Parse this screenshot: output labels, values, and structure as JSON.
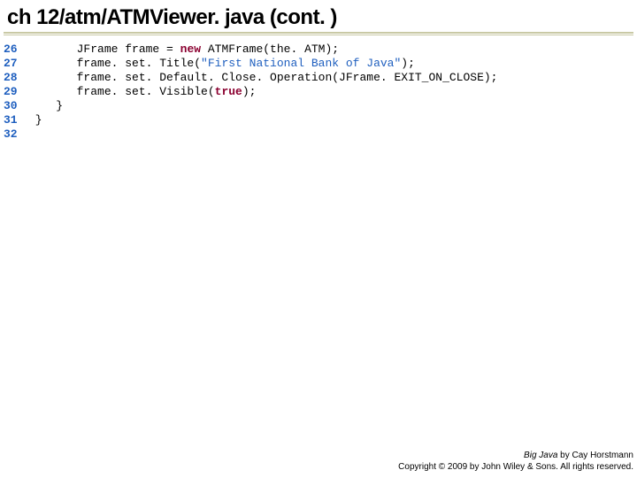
{
  "title": "ch 12/atm/ATMViewer. java (cont. )",
  "code": {
    "line_numbers": [
      "26",
      "27",
      "28",
      "29",
      "30",
      "31",
      "32"
    ],
    "l26_pre": "       JFrame frame = ",
    "l26_kw": "new",
    "l26_post": " ATMFrame(the. ATM);",
    "l27_pre": "       frame. set. Title(",
    "l27_str": "\"First National Bank of Java\"",
    "l27_post": ");",
    "l28": "       frame. set. Default. Close. Operation(JFrame. EXIT_ON_CLOSE);",
    "l29_pre": "       frame. set. Visible(",
    "l29_lit": "true",
    "l29_post": ");",
    "l30": "    }",
    "l31": " }",
    "l32": ""
  },
  "footer": {
    "line1_italic": "Big Java",
    "line1_rest": " by Cay Horstmann",
    "line2": "Copyright © 2009 by John Wiley & Sons. All rights reserved."
  }
}
